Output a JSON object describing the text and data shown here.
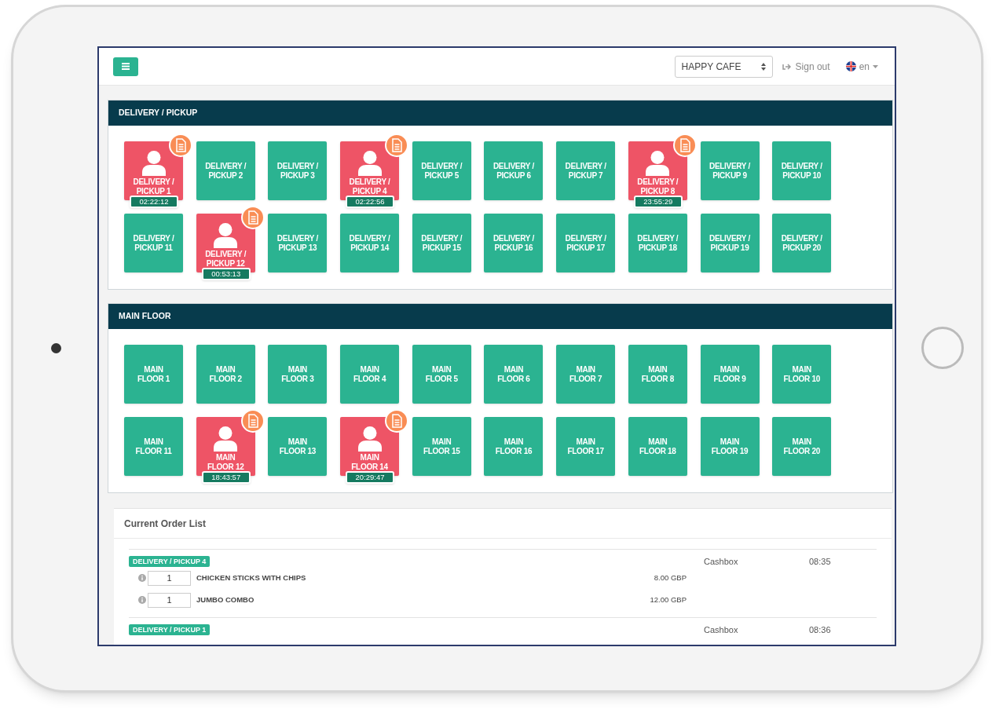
{
  "topbar": {
    "venue_select": "HAPPY CAFE",
    "sign_out": "Sign out",
    "language": "en"
  },
  "sections": [
    {
      "title": "DELIVERY / PICKUP",
      "tables": [
        {
          "label": "DELIVERY / PICKUP 1",
          "occupied": true,
          "timer": "02:22:12"
        },
        {
          "label": "DELIVERY / PICKUP 2",
          "occupied": false
        },
        {
          "label": "DELIVERY / PICKUP 3",
          "occupied": false
        },
        {
          "label": "DELIVERY / PICKUP 4",
          "occupied": true,
          "timer": "02:22:56"
        },
        {
          "label": "DELIVERY / PICKUP 5",
          "occupied": false
        },
        {
          "label": "DELIVERY / PICKUP 6",
          "occupied": false
        },
        {
          "label": "DELIVERY / PICKUP 7",
          "occupied": false
        },
        {
          "label": "DELIVERY / PICKUP 8",
          "occupied": true,
          "timer": "23:55:29"
        },
        {
          "label": "DELIVERY / PICKUP 9",
          "occupied": false
        },
        {
          "label": "DELIVERY / PICKUP 10",
          "occupied": false
        },
        {
          "label": "DELIVERY / PICKUP 11",
          "occupied": false
        },
        {
          "label": "DELIVERY / PICKUP 12",
          "occupied": true,
          "timer": "00:53:13"
        },
        {
          "label": "DELIVERY / PICKUP 13",
          "occupied": false
        },
        {
          "label": "DELIVERY / PICKUP 14",
          "occupied": false
        },
        {
          "label": "DELIVERY / PICKUP 15",
          "occupied": false
        },
        {
          "label": "DELIVERY / PICKUP 16",
          "occupied": false
        },
        {
          "label": "DELIVERY / PICKUP 17",
          "occupied": false
        },
        {
          "label": "DELIVERY / PICKUP 18",
          "occupied": false
        },
        {
          "label": "DELIVERY / PICKUP 19",
          "occupied": false
        },
        {
          "label": "DELIVERY / PICKUP 20",
          "occupied": false
        }
      ]
    },
    {
      "title": "MAIN FLOOR",
      "tables": [
        {
          "label": "MAIN FLOOR 1",
          "occupied": false
        },
        {
          "label": "MAIN FLOOR 2",
          "occupied": false
        },
        {
          "label": "MAIN FLOOR 3",
          "occupied": false
        },
        {
          "label": "MAIN FLOOR 4",
          "occupied": false
        },
        {
          "label": "MAIN FLOOR 5",
          "occupied": false
        },
        {
          "label": "MAIN FLOOR 6",
          "occupied": false
        },
        {
          "label": "MAIN FLOOR 7",
          "occupied": false
        },
        {
          "label": "MAIN FLOOR 8",
          "occupied": false
        },
        {
          "label": "MAIN FLOOR 9",
          "occupied": false
        },
        {
          "label": "MAIN FLOOR 10",
          "occupied": false
        },
        {
          "label": "MAIN FLOOR 11",
          "occupied": false
        },
        {
          "label": "MAIN FLOOR 12",
          "occupied": true,
          "timer": "18:43:57"
        },
        {
          "label": "MAIN FLOOR 13",
          "occupied": false
        },
        {
          "label": "MAIN FLOOR 14",
          "occupied": true,
          "timer": "20:29:47"
        },
        {
          "label": "MAIN FLOOR 15",
          "occupied": false
        },
        {
          "label": "MAIN FLOOR 16",
          "occupied": false
        },
        {
          "label": "MAIN FLOOR 17",
          "occupied": false
        },
        {
          "label": "MAIN FLOOR 18",
          "occupied": false
        },
        {
          "label": "MAIN FLOOR 19",
          "occupied": false
        },
        {
          "label": "MAIN FLOOR 20",
          "occupied": false
        }
      ]
    }
  ],
  "order_list": {
    "title": "Current Order List",
    "orders": [
      {
        "table": "DELIVERY / PICKUP 4",
        "source": "Cashbox",
        "time": "08:35",
        "items": [
          {
            "quantity": "1",
            "name": "CHICKEN STICKS WITH CHIPS",
            "price": "8.00 GBP"
          },
          {
            "quantity": "1",
            "name": "JUMBO COMBO",
            "price": "12.00 GBP"
          }
        ]
      },
      {
        "table": "DELIVERY / PICKUP 1",
        "source": "Cashbox",
        "time": "08:36"
      }
    ]
  }
}
